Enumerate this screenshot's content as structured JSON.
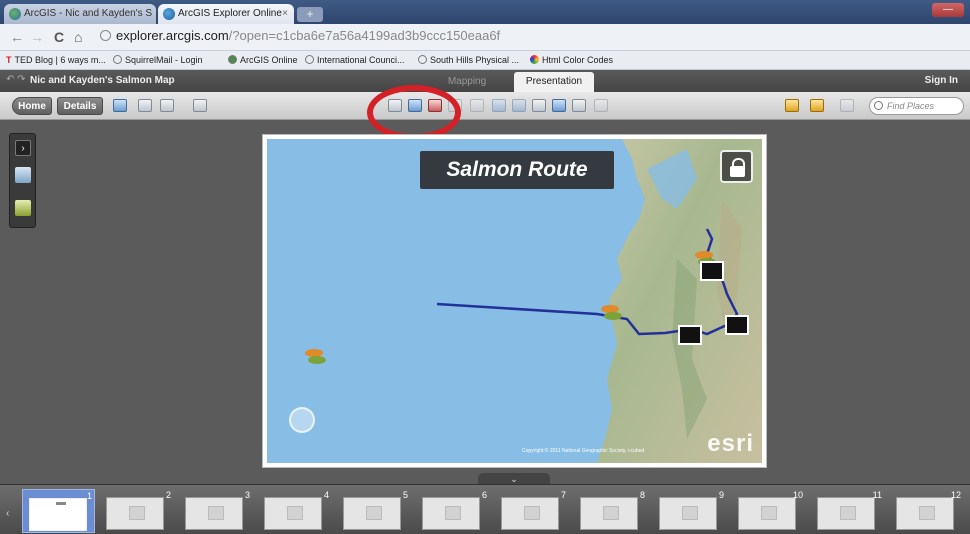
{
  "browser": {
    "tabs": [
      {
        "label": "ArcGIS - Nic and Kayden's S",
        "active": false
      },
      {
        "label": "ArcGIS Explorer Online",
        "active": true
      }
    ],
    "new_tab": "+",
    "window_control": "—",
    "address": {
      "domain": "explorer.arcgis.com",
      "path": "/?open=c1cba6e7a56a4199ad3b9ccc150eaa6f"
    },
    "bookmarks": [
      "TED Blog | 6 ways m...",
      "SquirrelMail - Login",
      "ArcGIS Online",
      "International Counci...",
      "South Hills Physical ...",
      "Html Color Codes"
    ]
  },
  "app": {
    "map_name": "Nic and Kayden's Salmon Map",
    "mode_tabs": [
      "Mapping",
      "Presentation"
    ],
    "active_mode": "Presentation",
    "sign_in": "Sign In",
    "toolbar": {
      "home_label": "Home",
      "details_label": "Details",
      "search_placeholder": "Find Places"
    }
  },
  "map": {
    "title": "Salmon Route",
    "attribution": "Copyright:© 2011 National Geographic Society, i-cubed",
    "logo": "esri"
  },
  "annotation": {
    "circle_color": "#d42027"
  },
  "route": {
    "color": "#22309a"
  },
  "slides": [
    {
      "number": "1",
      "selected": true
    },
    {
      "number": "2"
    },
    {
      "number": "3"
    },
    {
      "number": "4"
    },
    {
      "number": "5"
    },
    {
      "number": "6"
    },
    {
      "number": "7"
    },
    {
      "number": "8"
    },
    {
      "number": "9"
    },
    {
      "number": "10"
    },
    {
      "number": "11"
    },
    {
      "number": "12"
    }
  ]
}
